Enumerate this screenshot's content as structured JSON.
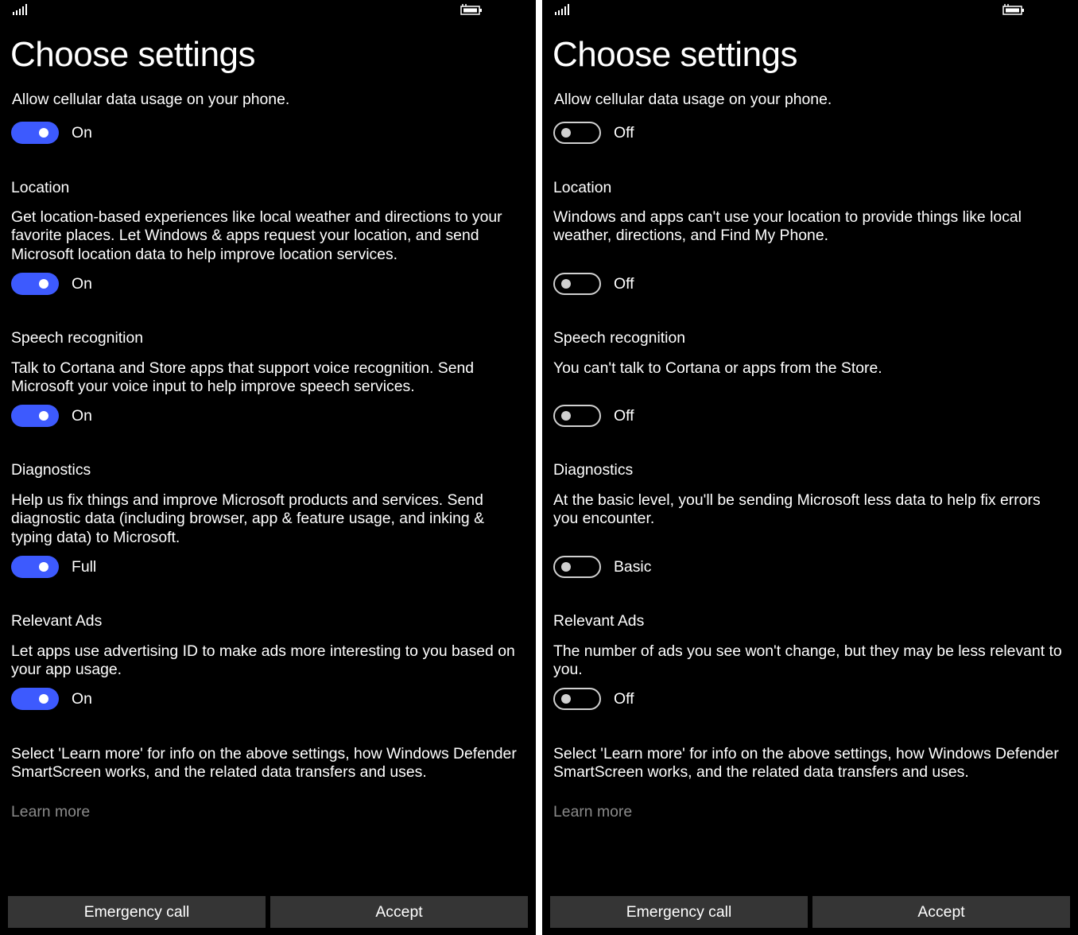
{
  "screens": [
    {
      "id": "left",
      "title": "Choose settings",
      "cellular": {
        "text": "Allow cellular data usage on your phone.",
        "toggle_state": "on",
        "toggle_label": "On"
      },
      "location": {
        "heading": "Location",
        "desc": "Get location-based experiences like local weather and directions to your favorite places. Let Windows & apps request your location, and send Microsoft location data to help improve location services.",
        "toggle_state": "on",
        "toggle_label": "On"
      },
      "speech": {
        "heading": "Speech recognition",
        "desc": "Talk to Cortana and Store apps that support voice recognition. Send Microsoft your voice input to help improve speech services.",
        "toggle_state": "on",
        "toggle_label": "On"
      },
      "diagnostics": {
        "heading": "Diagnostics",
        "desc": "Help us fix things and improve Microsoft products and services. Send diagnostic data (including browser, app & feature usage, and inking & typing data) to Microsoft.",
        "toggle_state": "on",
        "toggle_label": "Full"
      },
      "ads": {
        "heading": "Relevant Ads",
        "desc": "Let apps use advertising ID to make ads more interesting to you based on your app usage.",
        "toggle_state": "on",
        "toggle_label": "On"
      },
      "info_text": "Select 'Learn more' for info on the above settings, how Windows Defender SmartScreen works, and the related data transfers and uses.",
      "learn_more": "Learn more",
      "emergency_label": "Emergency call",
      "accept_label": "Accept"
    },
    {
      "id": "right",
      "title": "Choose settings",
      "cellular": {
        "text": "Allow cellular data usage on your phone.",
        "toggle_state": "off",
        "toggle_label": "Off"
      },
      "location": {
        "heading": "Location",
        "desc": "Windows and apps can't use your location to provide things like local weather, directions, and Find My Phone.",
        "toggle_state": "off",
        "toggle_label": "Off"
      },
      "speech": {
        "heading": "Speech recognition",
        "desc": "You can't talk to Cortana or apps from the Store.",
        "toggle_state": "off",
        "toggle_label": "Off"
      },
      "diagnostics": {
        "heading": "Diagnostics",
        "desc": "At the basic level, you'll be sending Microsoft less data to help fix errors you encounter.",
        "toggle_state": "off",
        "toggle_label": "Basic"
      },
      "ads": {
        "heading": "Relevant Ads",
        "desc": "The number of ads you see won't change, but they may be less relevant to you.",
        "toggle_state": "off",
        "toggle_label": "Off"
      },
      "info_text": "Select 'Learn more' for info on the above settings, how Windows Defender SmartScreen works, and the related data transfers and uses.",
      "learn_more": "Learn more",
      "emergency_label": "Emergency call",
      "accept_label": "Accept"
    }
  ],
  "colors": {
    "toggle_on": "#3d5afe",
    "background": "#000000",
    "button": "#353535",
    "link": "#8a8a8a"
  },
  "icons": {
    "status_signal": "signal-bars-icon",
    "status_battery": "battery-charging-icon"
  }
}
